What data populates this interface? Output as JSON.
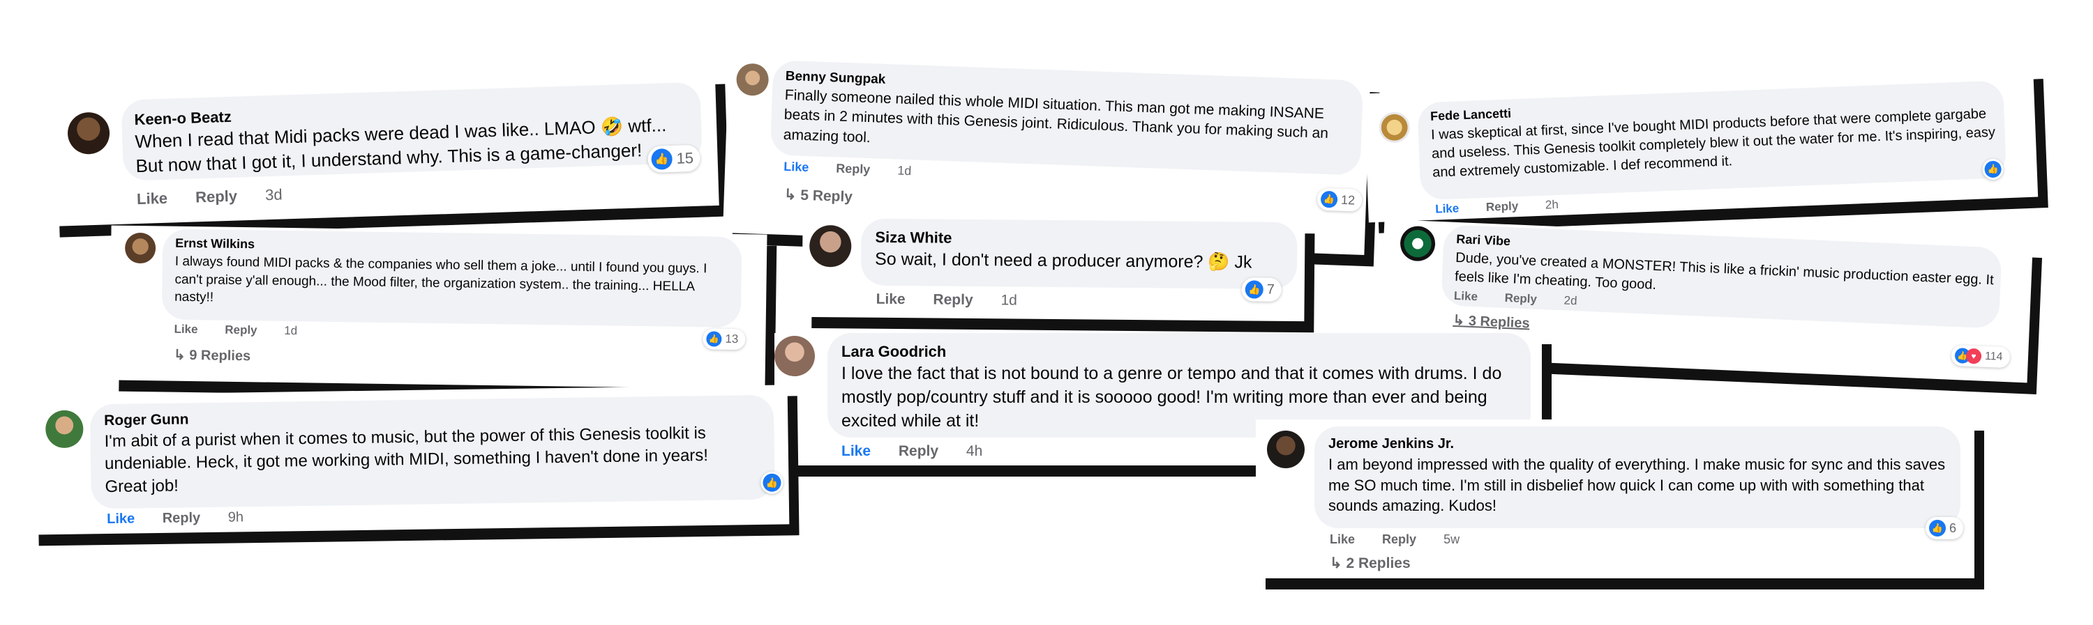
{
  "comments": [
    {
      "name": "Keen-o Beatz",
      "text": "When I read that Midi packs were dead I was like.. LMAO 🤣 wtf... But now that I got it, I understand why. This is a game-changer!",
      "like": "Like",
      "reply": "Reply",
      "time": "3d",
      "reactions": "15"
    },
    {
      "name": "Benny Sungpak",
      "text": "Finally someone nailed this whole MIDI situation. This man got me making INSANE beats in 2 minutes with this Genesis joint. Ridiculous. Thank you for making such an amazing tool.",
      "like": "Like",
      "reply": "Reply",
      "time": "1d",
      "replies": "5 Reply",
      "reactions": "12"
    },
    {
      "name": "Fede Lancetti",
      "text": "I was skeptical at first, since I've bought MIDI products before that were complete gargabe and useless. This Genesis toolkit completely blew it out the water for me. It's inspiring, easy and extremely customizable. I def recommend it.",
      "like": "Like",
      "reply": "Reply",
      "time": "2h"
    },
    {
      "name": "Ernst Wilkins",
      "text": "I always found MIDI packs & the companies who sell them a joke... until I found you guys. I can't praise y'all enough... the Mood filter, the organization system.. the training... HELLA nasty!!",
      "like": "Like",
      "reply": "Reply",
      "time": "1d",
      "replies": "9 Replies",
      "reactions": "13"
    },
    {
      "name": "Siza White",
      "text": "So wait, I don't need a producer anymore? 🤔 Jk",
      "like": "Like",
      "reply": "Reply",
      "time": "1d",
      "reactions": "7"
    },
    {
      "name": "Rari Vibe",
      "text": "Dude, you've created a MONSTER! This is like a frickin' music production easter egg. It feels like I'm cheating. Too good.",
      "like": "Like",
      "reply": "Reply",
      "time": "2d",
      "replies": "3 Replies",
      "reactions": "114"
    },
    {
      "name": "Lara Goodrich",
      "text": "I love the fact that is not bound to a genre or tempo and that it comes with drums. I do mostly pop/country stuff and it is sooooo good! I'm writing more than ever and being excited while at it!",
      "like": "Like",
      "reply": "Reply",
      "time": "4h"
    },
    {
      "name": "Roger Gunn",
      "text": "I'm abit of a purist when it comes to music, but the power of this Genesis toolkit is undeniable. Heck, it got me working with MIDI, something I haven't done in years! Great job!",
      "like": "Like",
      "reply": "Reply",
      "time": "9h"
    },
    {
      "name": "Jerome Jenkins Jr.",
      "text": "I am beyond impressed with the quality of everything. I make music for sync and this saves me SO much time. I'm still in disbelief how quick I can come up with with something that sounds amazing. Kudos!",
      "like": "Like",
      "reply": "Reply",
      "time": "5w",
      "replies": "2 Replies",
      "reactions": "6"
    }
  ],
  "colors": {
    "like_blue": "#1877f2",
    "bubble": "#f0f2f5",
    "shadow": "#111111",
    "heart": "#f33e58"
  },
  "icons": {
    "like": "thumbs-up-icon",
    "love": "heart-icon",
    "reply_arrow": "reply-arrow-icon"
  }
}
